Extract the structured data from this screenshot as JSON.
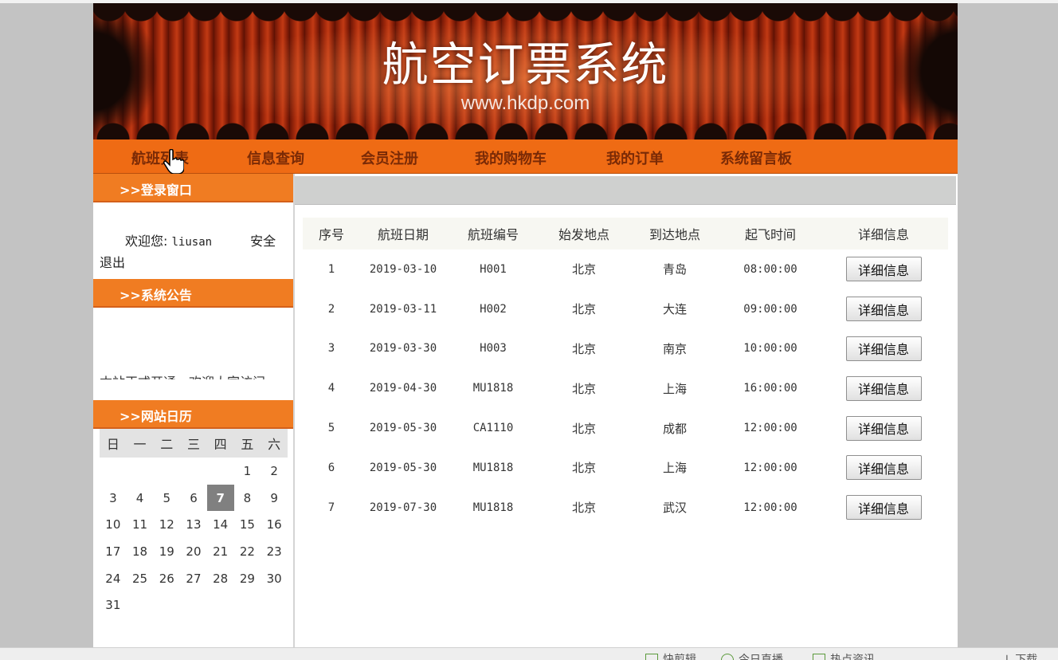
{
  "header": {
    "title": "航空订票系统",
    "url": "www.hkdp.com"
  },
  "nav": {
    "items": [
      "航班列表",
      "信息查询",
      "会员注册",
      "我的购物车",
      "我的订单",
      "系统留言板"
    ]
  },
  "sidebar": {
    "login_title": ">>登录窗口",
    "welcome_label": "欢迎您:",
    "username": "liusan",
    "logout": "安全退出",
    "notice_title": ">>系统公告",
    "notice_text": "本站正式开通，欢迎大家访问",
    "calendar_title": ">>网站日历",
    "calendar": {
      "weekdays": [
        "日",
        "一",
        "二",
        "三",
        "四",
        "五",
        "六"
      ],
      "today": "7",
      "weeks": [
        [
          "",
          "",
          "",
          "",
          "",
          "1",
          "2"
        ],
        [
          "3",
          "4",
          "5",
          "6",
          "7",
          "8",
          "9"
        ],
        [
          "10",
          "11",
          "12",
          "13",
          "14",
          "15",
          "16"
        ],
        [
          "17",
          "18",
          "19",
          "20",
          "21",
          "22",
          "23"
        ],
        [
          "24",
          "25",
          "26",
          "27",
          "28",
          "29",
          "30"
        ],
        [
          "31",
          "",
          "",
          "",
          "",
          "",
          ""
        ]
      ]
    }
  },
  "flights": {
    "columns": [
      "序号",
      "航班日期",
      "航班编号",
      "始发地点",
      "到达地点",
      "起飞时间",
      "详细信息"
    ],
    "button_label": "详细信息",
    "rows": [
      {
        "no": "1",
        "date": "2019-03-10",
        "code": "H001",
        "from": "北京",
        "to": "青岛",
        "time": "08:00:00"
      },
      {
        "no": "2",
        "date": "2019-03-11",
        "code": "H002",
        "from": "北京",
        "to": "大连",
        "time": "09:00:00"
      },
      {
        "no": "3",
        "date": "2019-03-30",
        "code": "H003",
        "from": "北京",
        "to": "南京",
        "time": "10:00:00"
      },
      {
        "no": "4",
        "date": "2019-04-30",
        "code": "MU1818",
        "from": "北京",
        "to": "上海",
        "time": "16:00:00"
      },
      {
        "no": "5",
        "date": "2019-05-30",
        "code": "CA1110",
        "from": "北京",
        "to": "成都",
        "time": "12:00:00"
      },
      {
        "no": "6",
        "date": "2019-05-30",
        "code": "MU1818",
        "from": "北京",
        "to": "上海",
        "time": "12:00:00"
      },
      {
        "no": "7",
        "date": "2019-07-30",
        "code": "MU1818",
        "from": "北京",
        "to": "武汉",
        "time": "12:00:00"
      }
    ]
  },
  "taskbar": {
    "items": [
      "快剪辑",
      "今日直播",
      "热点资讯",
      "下载"
    ]
  }
}
